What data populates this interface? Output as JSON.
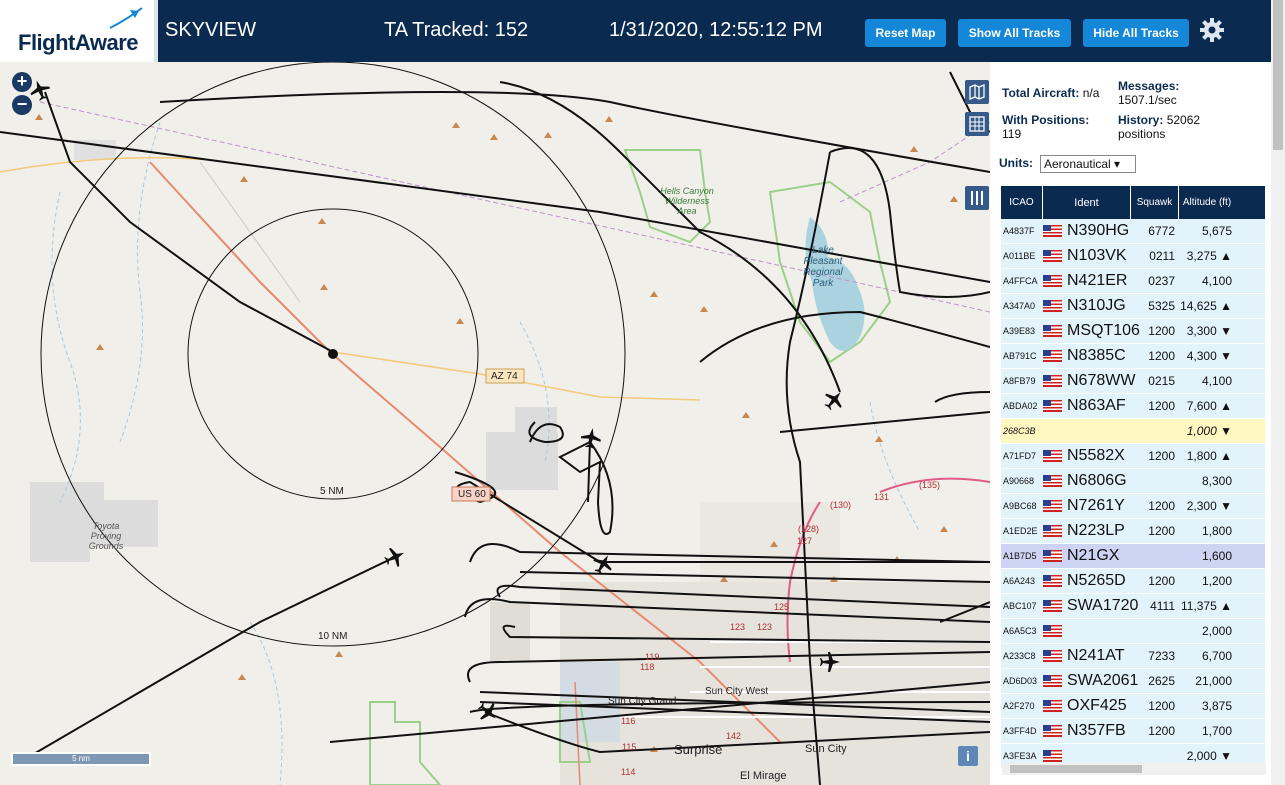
{
  "header": {
    "brand": "FlightAware",
    "title": "SKYVIEW",
    "tracked": "TA Tracked: 152",
    "datetime": "1/31/2020, 12:55:12 PM",
    "buttons": {
      "reset": "Reset Map",
      "show_all": "Show All Tracks",
      "hide_all": "Hide All Tracks"
    }
  },
  "map": {
    "zoom_in": "+",
    "zoom_out": "−",
    "scale_label": "5 nm",
    "info": "i",
    "labels": {
      "ring5": "5 NM",
      "ring10": "10 NM",
      "az74": "AZ 74",
      "us60": "US 60",
      "hells_canyon": "Hells Canyon Wilderness Area",
      "lake_pleasant": "Lake Pleasant Regional Park",
      "toyota": "Toyota Proving Grounds",
      "sun_city_grand": "Sun City Grand",
      "sun_city_west": "Sun City West",
      "surprise": "Surprise",
      "sun_city": "Sun City",
      "el_mirage": "El Mirage",
      "r131": "131",
      "r135": "(135)",
      "r130": "(130)",
      "r128": "(128)",
      "r127": "127",
      "r125": "125",
      "r123a": "123",
      "r123b": "123",
      "r119": "119",
      "r118": "118",
      "r116": "116",
      "r115": "115",
      "r114": "114",
      "r142": "142"
    }
  },
  "sidebar": {
    "total_label": "Total Aircraft:",
    "total_value": "n/a",
    "with_pos_label": "With Positions:",
    "with_pos_value": "119",
    "messages_label": "Messages:",
    "messages_value": "1507.1/sec",
    "history_label": "History:",
    "history_value": "52062 positions",
    "units_label": "Units:",
    "units_value": "Aeronautical ▾",
    "columns": [
      "ICAO",
      "Ident",
      "Squawk",
      "Altitude (ft)"
    ],
    "rows": [
      {
        "icao": "A4837F",
        "ident": "N390HG",
        "squawk": "6772",
        "alt": "5,675",
        "flag": true
      },
      {
        "icao": "A011BE",
        "ident": "N103VK",
        "squawk": "0211",
        "alt": "3,275 ▲",
        "flag": true
      },
      {
        "icao": "A4FFCA",
        "ident": "N421ER",
        "squawk": "0237",
        "alt": "4,100",
        "flag": true
      },
      {
        "icao": "A347A0",
        "ident": "N310JG",
        "squawk": "5325",
        "alt": "14,625 ▲",
        "flag": true
      },
      {
        "icao": "A39E83",
        "ident": "MSQT106",
        "squawk": "1200",
        "alt": "3,300 ▼",
        "flag": true
      },
      {
        "icao": "AB791C",
        "ident": "N8385C",
        "squawk": "1200",
        "alt": "4,300 ▼",
        "flag": true
      },
      {
        "icao": "A8FB79",
        "ident": "N678WW",
        "squawk": "0215",
        "alt": "4,100",
        "flag": true
      },
      {
        "icao": "ABDA02",
        "ident": "N863AF",
        "squawk": "1200",
        "alt": "7,600 ▲",
        "flag": true
      },
      {
        "icao": "268C3B",
        "ident": "",
        "squawk": "",
        "alt": "1,000 ▼",
        "flag": false
      },
      {
        "icao": "A71FD7",
        "ident": "N5582X",
        "squawk": "1200",
        "alt": "1,800 ▲",
        "flag": true
      },
      {
        "icao": "A90668",
        "ident": "N6806G",
        "squawk": "",
        "alt": "8,300",
        "flag": true
      },
      {
        "icao": "A9BC68",
        "ident": "N7261Y",
        "squawk": "1200",
        "alt": "2,300 ▼",
        "flag": true
      },
      {
        "icao": "A1ED2E",
        "ident": "N223LP",
        "squawk": "1200",
        "alt": "1,800",
        "flag": true
      },
      {
        "icao": "A1B7D5",
        "ident": "N21GX",
        "squawk": "",
        "alt": "1,600",
        "flag": true
      },
      {
        "icao": "A6A243",
        "ident": "N5265D",
        "squawk": "1200",
        "alt": "1,200",
        "flag": true
      },
      {
        "icao": "ABC107",
        "ident": "SWA1720",
        "squawk": "4111",
        "alt": "11,375 ▲",
        "flag": true
      },
      {
        "icao": "A6A5C3",
        "ident": "",
        "squawk": "",
        "alt": "2,000",
        "flag": true
      },
      {
        "icao": "A233C8",
        "ident": "N241AT",
        "squawk": "7233",
        "alt": "6,700",
        "flag": true
      },
      {
        "icao": "AD6D03",
        "ident": "SWA2061",
        "squawk": "2625",
        "alt": "21,000",
        "flag": true
      },
      {
        "icao": "A2F270",
        "ident": "OXF425",
        "squawk": "1200",
        "alt": "3,875",
        "flag": true
      },
      {
        "icao": "A3FF4D",
        "ident": "N357FB",
        "squawk": "1200",
        "alt": "1,700",
        "flag": true
      },
      {
        "icao": "A3FE3A",
        "ident": "",
        "squawk": "",
        "alt": "2,000 ▼",
        "flag": true
      }
    ]
  }
}
